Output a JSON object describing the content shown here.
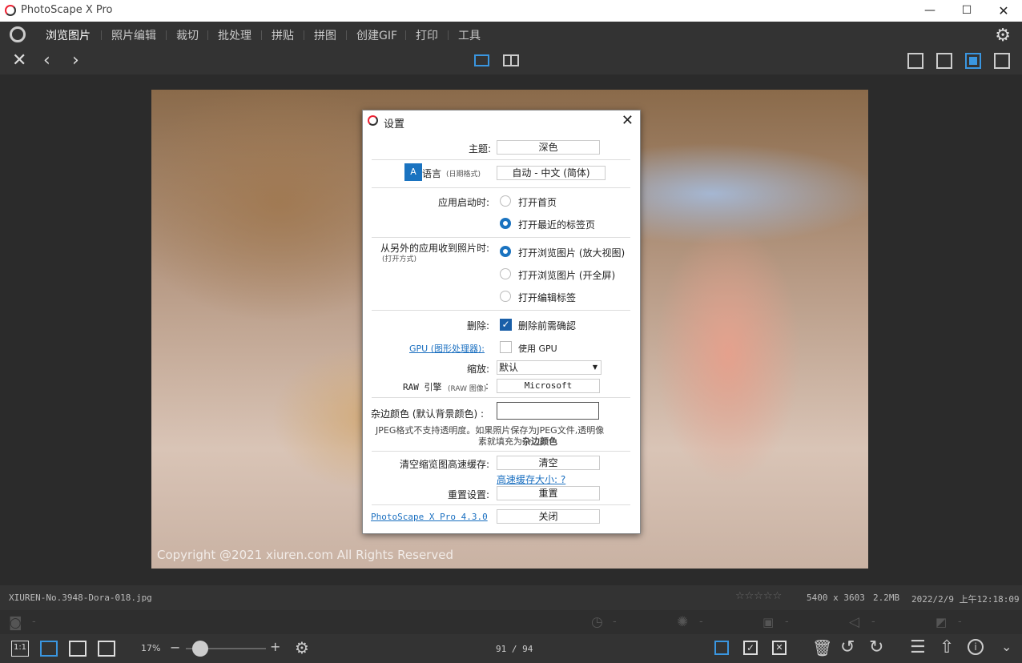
{
  "window": {
    "title": "PhotoScape X Pro"
  },
  "menu": {
    "items": [
      "浏览图片",
      "照片编辑",
      "裁切",
      "批处理",
      "拼贴",
      "拼图",
      "创建GIF",
      "打印",
      "工具"
    ]
  },
  "photo": {
    "copyright": "Copyright @2021  xiuren.com  All Rights Reserved"
  },
  "info": {
    "filename": "XIUREN-No.3948-Dora-018.jpg",
    "rating": "☆☆☆☆☆",
    "dimensions": "5400 x 3603",
    "size": "2.2MB",
    "date": "2022/2/9 上午12:18:09"
  },
  "exif": {
    "dash": "-"
  },
  "bottom": {
    "ratio_label": "1:1",
    "zoom": "17%",
    "zoom_minus": "−",
    "zoom_plus": "+",
    "zoom_level": 0.06,
    "page": "91 / 94"
  },
  "dialog": {
    "title": "设置",
    "theme_label": "主题:",
    "theme_value": "深色",
    "lang_label": "语言",
    "lang_sub": "(日期格式)",
    "lang_value": "自动 - 中文 (简体)",
    "startup_label": "应用启动时:",
    "startup_opt1": "打开首页",
    "startup_opt2": "打开最近的标签页",
    "receive_label": "从另外的应用收到照片时:",
    "receive_sub": "(打开方式)",
    "receive_opt1": "打开浏览图片 (放大视图)",
    "receive_opt2": "打开浏览图片 (开全屏)",
    "receive_opt3": "打开编辑标签",
    "delete_label": "删除:",
    "delete_check": "删除前需确認",
    "gpu_link": "GPU (图形处理器):",
    "gpu_check": "使用 GPU",
    "zoom_label": "缩放:",
    "zoom_value": "默认",
    "raw_label": "RAW 引擎",
    "raw_sub": "(RAW 图像)",
    "raw_colon": ":",
    "raw_value": "Microsoft",
    "matte_label": "杂边颜色 (默认背景颜色) :",
    "matte_note1": "JPEG格式不支持透明度。如果照片保存为JPEG文件,透明像",
    "matte_note2a": "素就填充为",
    "matte_note2b": "杂边颜色",
    "cache_label": "清空缩览图高速缓存:",
    "cache_button": "清空",
    "cache_link": "高速缓存大小: ?",
    "reset_label": "重置设置:",
    "reset_button": "重置",
    "version_link": "PhotoScape X Pro 4.3.0",
    "close_button": "关闭"
  }
}
